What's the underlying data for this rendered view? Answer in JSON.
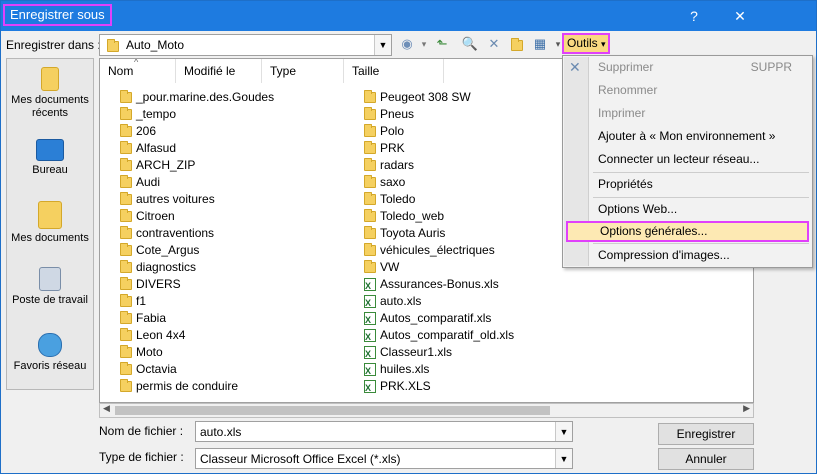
{
  "window": {
    "title": "Enregistrer sous",
    "help_label": "?",
    "close_label": "✕"
  },
  "toolbar": {
    "save_in_label": "Enregistrer dans :",
    "current_folder": "Auto_Moto",
    "tools_label": "Outils",
    "tools_arrow": "▾",
    "icons": [
      "back-icon",
      "up-folder-icon",
      "search-web-icon",
      "delete-icon",
      "new-folder-icon",
      "views-icon"
    ]
  },
  "places": [
    {
      "label": "Mes documents récents",
      "icon": "recent-documents-icon"
    },
    {
      "label": "Bureau",
      "icon": "desktop-icon"
    },
    {
      "label": "Mes documents",
      "icon": "my-documents-icon"
    },
    {
      "label": "Poste de travail",
      "icon": "computer-icon"
    },
    {
      "label": "Favoris réseau",
      "icon": "network-places-icon"
    }
  ],
  "list": {
    "columns": [
      "Nom",
      "Modifié le",
      "Type",
      "Taille"
    ],
    "col1": [
      {
        "name": "_pour.marine.des.Goudes",
        "kind": "folder"
      },
      {
        "name": "_tempo",
        "kind": "folder"
      },
      {
        "name": "206",
        "kind": "folder"
      },
      {
        "name": "Alfasud",
        "kind": "folder"
      },
      {
        "name": "ARCH_ZIP",
        "kind": "folder"
      },
      {
        "name": "Audi",
        "kind": "folder"
      },
      {
        "name": "autres voitures",
        "kind": "folder"
      },
      {
        "name": "Citroen",
        "kind": "folder"
      },
      {
        "name": "contraventions",
        "kind": "folder"
      },
      {
        "name": "Cote_Argus",
        "kind": "folder"
      },
      {
        "name": "diagnostics",
        "kind": "folder"
      },
      {
        "name": "DIVERS",
        "kind": "folder"
      },
      {
        "name": "f1",
        "kind": "folder"
      },
      {
        "name": "Fabia",
        "kind": "folder"
      },
      {
        "name": "Leon 4x4",
        "kind": "folder"
      },
      {
        "name": "Moto",
        "kind": "folder"
      },
      {
        "name": "Octavia",
        "kind": "folder"
      },
      {
        "name": "permis de conduire",
        "kind": "folder"
      }
    ],
    "col2": [
      {
        "name": "Peugeot 308 SW",
        "kind": "folder"
      },
      {
        "name": "Pneus",
        "kind": "folder"
      },
      {
        "name": "Polo",
        "kind": "folder"
      },
      {
        "name": "PRK",
        "kind": "folder"
      },
      {
        "name": "radars",
        "kind": "folder"
      },
      {
        "name": "saxo",
        "kind": "folder"
      },
      {
        "name": "Toledo",
        "kind": "folder"
      },
      {
        "name": "Toledo_web",
        "kind": "folder"
      },
      {
        "name": "Toyota Auris",
        "kind": "folder"
      },
      {
        "name": "véhicules_électriques",
        "kind": "folder"
      },
      {
        "name": "VW",
        "kind": "folder"
      },
      {
        "name": "Assurances-Bonus.xls",
        "kind": "xls"
      },
      {
        "name": "auto.xls",
        "kind": "xls"
      },
      {
        "name": "Autos_comparatif.xls",
        "kind": "xls"
      },
      {
        "name": "Autos_comparatif_old.xls",
        "kind": "xls"
      },
      {
        "name": "Classeur1.xls",
        "kind": "xls"
      },
      {
        "name": "huiles.xls",
        "kind": "xls"
      },
      {
        "name": "PRK.XLS",
        "kind": "xls"
      }
    ]
  },
  "form": {
    "filename_label": "Nom de fichier :",
    "filename_value": "auto.xls",
    "filetype_label": "Type de fichier :",
    "filetype_value": "Classeur Microsoft Office Excel (*.xls)",
    "save_button": "Enregistrer",
    "cancel_button": "Annuler"
  },
  "menu": {
    "items": [
      {
        "label": "Supprimer",
        "shortcut": "SUPPR",
        "disabled": true
      },
      {
        "label": "Renommer",
        "shortcut": "",
        "disabled": true
      },
      {
        "label": "Imprimer",
        "shortcut": "",
        "disabled": true
      },
      {
        "label": "Ajouter à « Mon environnement »",
        "shortcut": "",
        "disabled": false
      },
      {
        "label": "Connecter un lecteur réseau...",
        "shortcut": "",
        "disabled": false
      },
      {
        "label": "Propriétés",
        "shortcut": "",
        "disabled": false
      },
      {
        "label": "Options Web...",
        "shortcut": "",
        "disabled": false
      },
      {
        "label": "Options générales...",
        "shortcut": "",
        "disabled": false,
        "highlighted": true
      },
      {
        "label": "Compression d'images...",
        "shortcut": "",
        "disabled": false
      }
    ]
  },
  "colors": {
    "titlebar": "#1e7be0",
    "highlight_outline": "#e040fb",
    "menu_hover": "#fde9b3"
  }
}
